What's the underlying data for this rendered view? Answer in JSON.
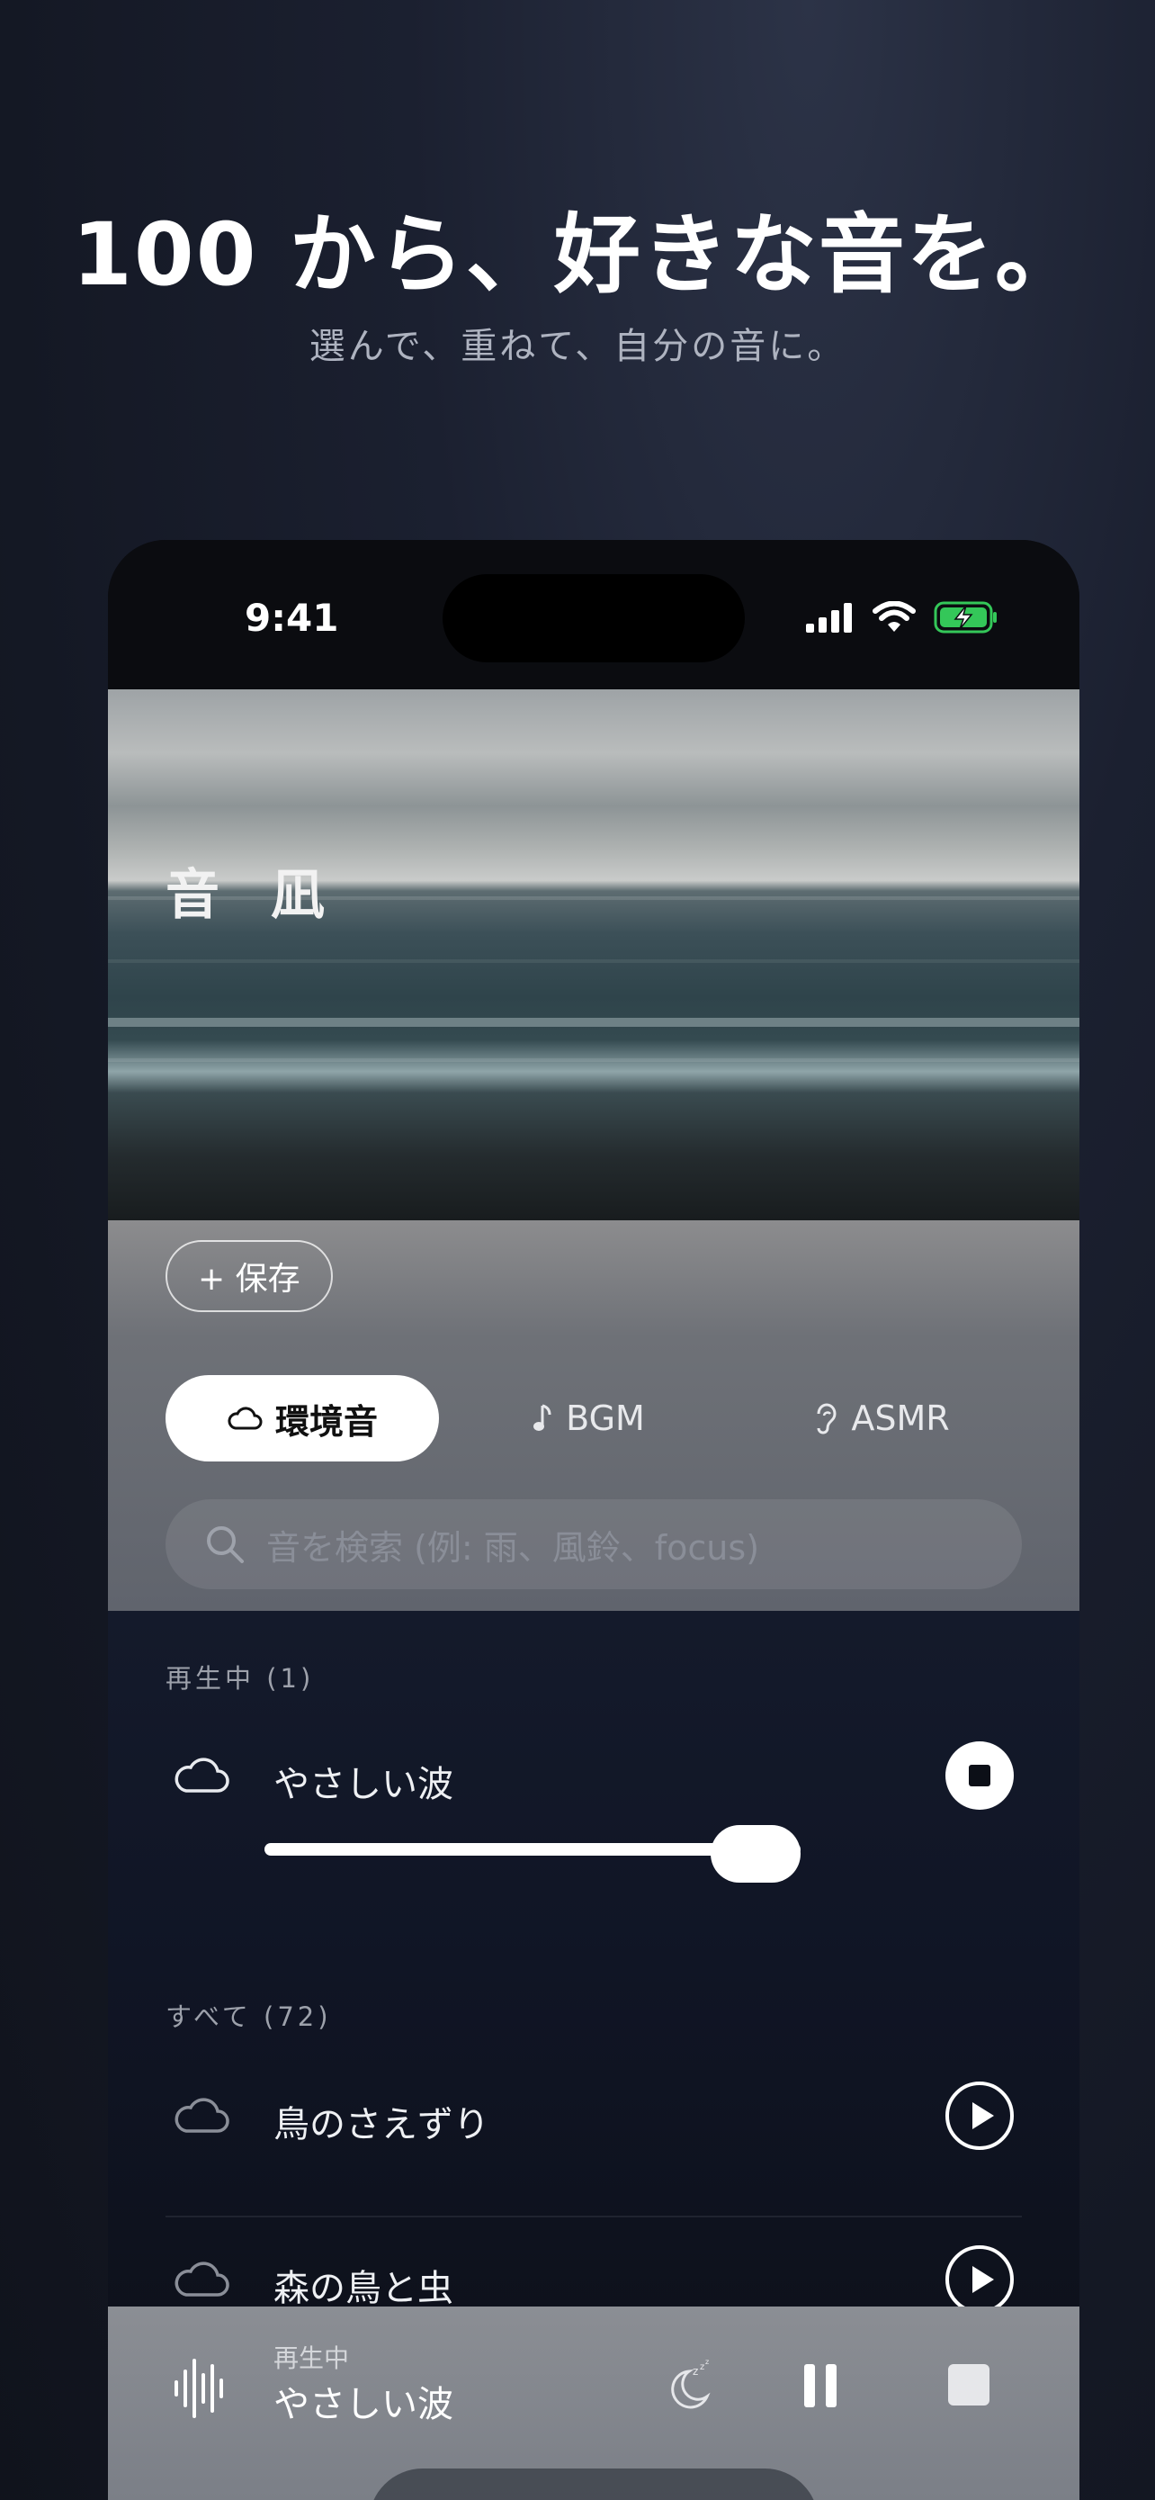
{
  "promo": {
    "headline": "100 から、好きな音を。",
    "subline": "選んで、重ねて、自分の音に。"
  },
  "status_bar": {
    "time": "9:41"
  },
  "hero": {
    "app_logo": "音 凪"
  },
  "toolbar": {
    "save_label": "+ 保存"
  },
  "tabs": [
    {
      "label": "環境音",
      "icon": "cloud-icon",
      "active": true
    },
    {
      "label": "BGM",
      "icon": "music-note-icon",
      "active": false
    },
    {
      "label": "ASMR",
      "icon": "ear-icon",
      "active": false
    }
  ],
  "search": {
    "placeholder": "音を検索 (例: 雨、風鈴、focus)"
  },
  "playing_section": {
    "label": "再生中 (1)",
    "items": [
      {
        "name": "やさしい波",
        "icon": "cloud-icon",
        "action": "stop",
        "volume": 0.8
      }
    ]
  },
  "all_section": {
    "label": "すべて (72)",
    "items": [
      {
        "name": "鳥のさえずり",
        "icon": "cloud-icon",
        "action": "play"
      },
      {
        "name": "森の鳥と虫",
        "icon": "cloud-icon",
        "action": "play"
      }
    ]
  },
  "mini_player": {
    "status": "再生中",
    "title": "やさしい波",
    "controls": [
      "sleep-timer-icon",
      "pause-icon",
      "stop-icon"
    ]
  },
  "colors": {
    "battery": "#34c759",
    "accent": "#ffffff"
  }
}
